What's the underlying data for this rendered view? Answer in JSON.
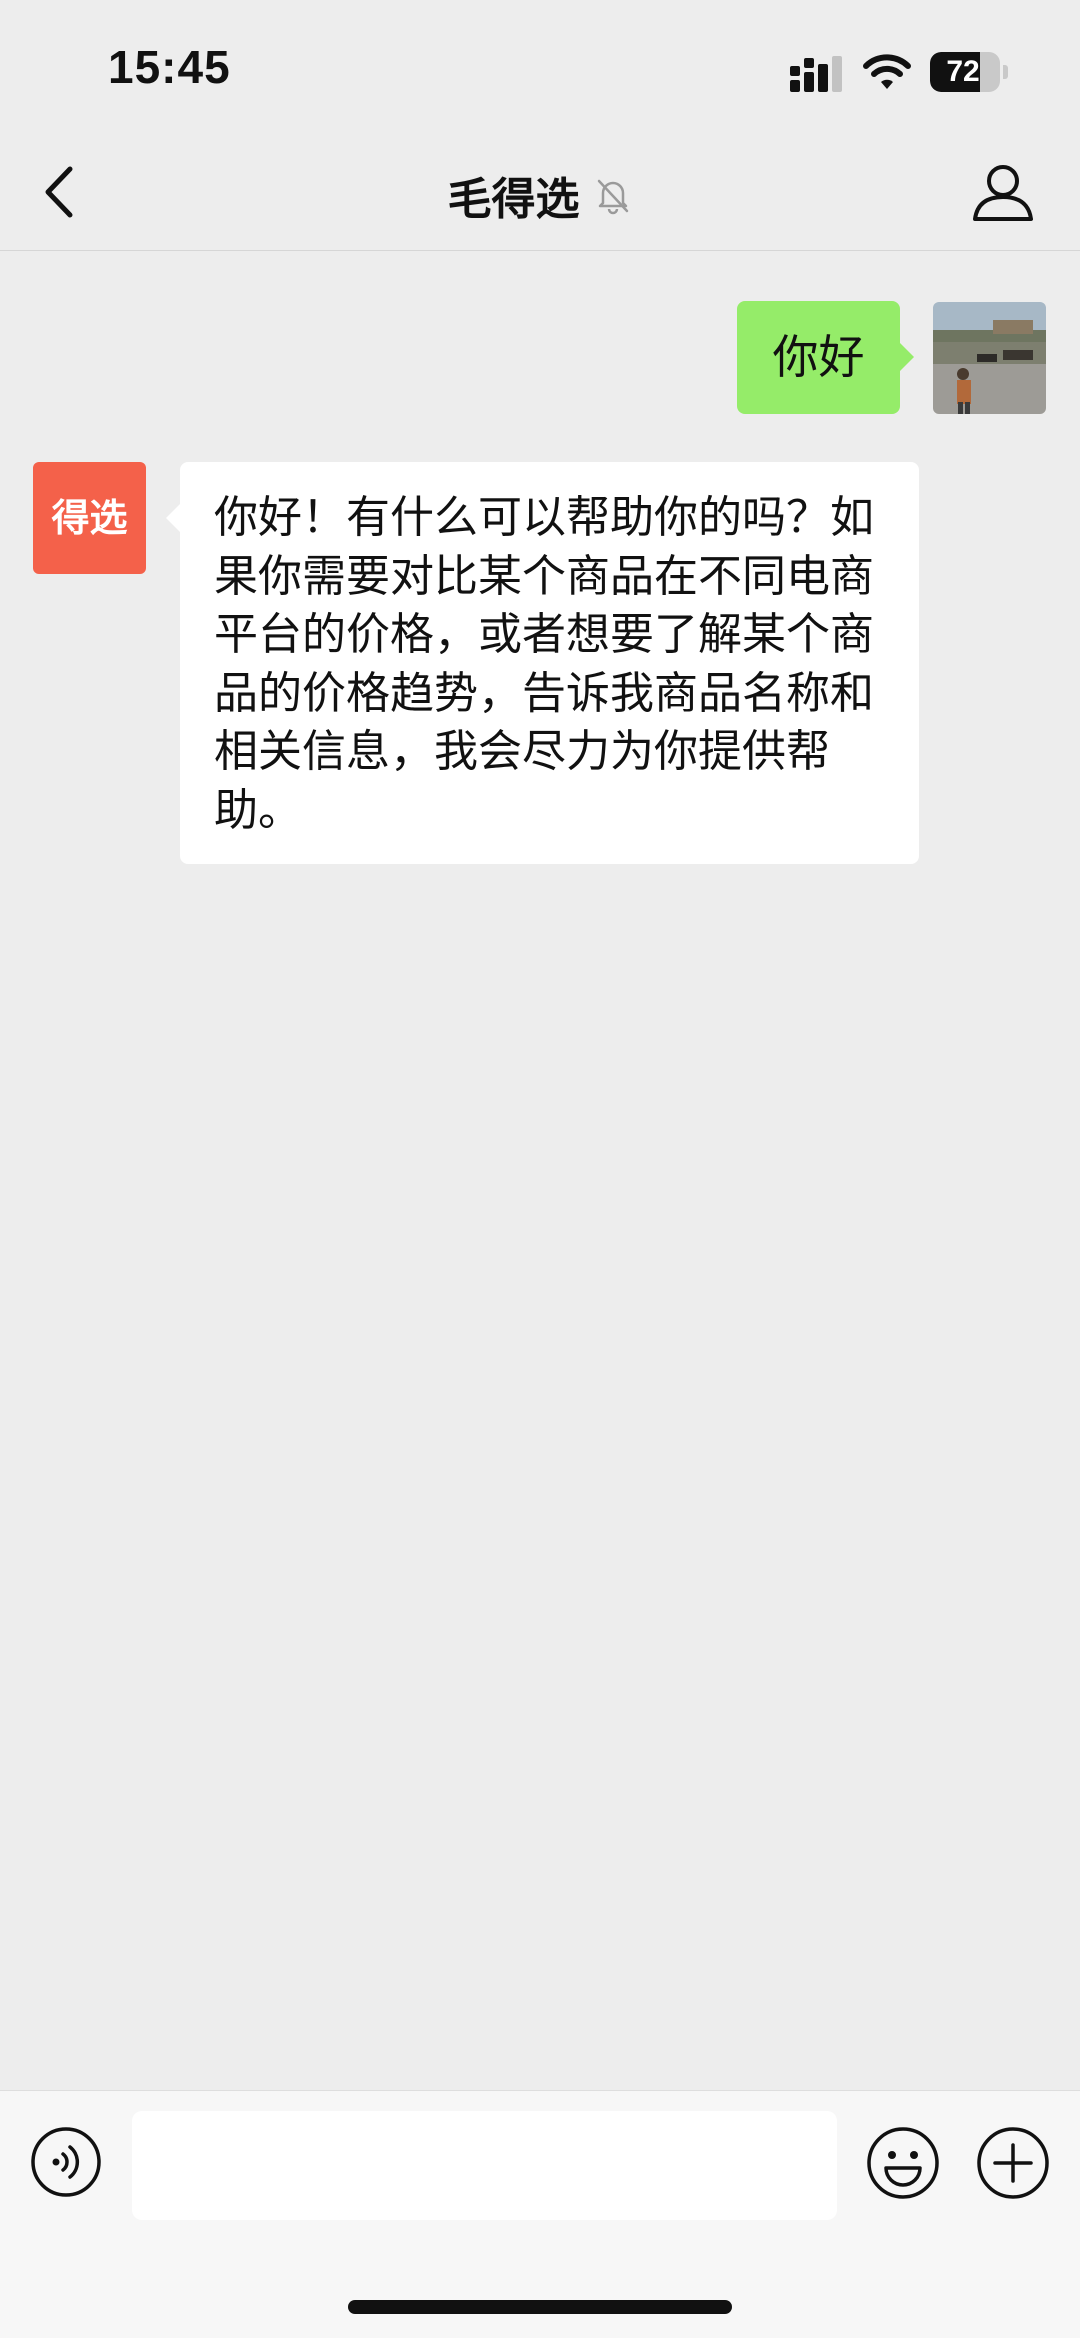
{
  "status_bar": {
    "time": "15:45",
    "battery": "72",
    "battery_level": 0.72,
    "signal_icon": "cellular-signal-icon",
    "wifi_icon": "wifi-icon"
  },
  "header": {
    "title": "毛得选",
    "back_icon": "chevron-left-icon",
    "mute_icon": "bell-slash-icon",
    "profile_icon": "person-icon"
  },
  "messages": [
    {
      "sender": "me",
      "text": "你好",
      "avatar": "user-photo-avatar"
    },
    {
      "sender": "bot",
      "avatar_text": "得选",
      "text": "你好！有什么可以帮助你的吗？如果你需要对比某个商品在不同电商平台的价格，或者想要了解某个商品的价格趋势，告诉我商品名称和相关信息，我会尽力为你提供帮助。"
    }
  ],
  "input_bar": {
    "value": "",
    "voice_icon": "voice-icon",
    "emoji_icon": "emoji-smile-icon",
    "plus_icon": "plus-circle-icon"
  },
  "colors": {
    "background": "#ededed",
    "outgoing_bubble": "#95ec69",
    "incoming_bubble": "#ffffff",
    "bot_avatar": "#f4614a"
  }
}
